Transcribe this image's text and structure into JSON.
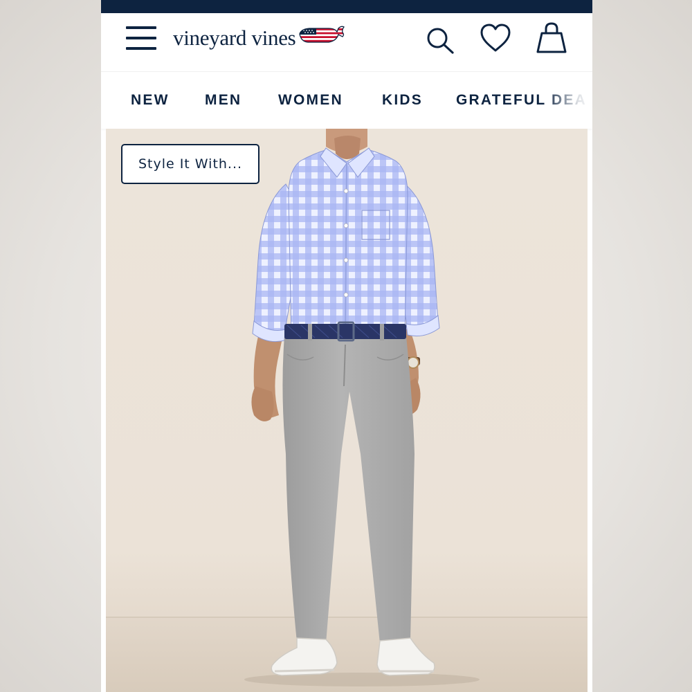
{
  "brand": {
    "name": "vineyard vines",
    "logo_icon": "flag-whale-icon",
    "colors": {
      "navy": "#0d2340",
      "flag_red": "#c8102e",
      "white": "#ffffff"
    }
  },
  "header": {
    "menu_icon": "hamburger-menu-icon",
    "search_icon": "search-icon",
    "wishlist_icon": "heart-icon",
    "cart_icon": "shopping-bag-icon"
  },
  "nav": {
    "items": [
      {
        "label": "NEW"
      },
      {
        "label": "MEN"
      },
      {
        "label": "WOMEN"
      },
      {
        "label": "KIDS"
      },
      {
        "label": "GRATEFUL DEA"
      }
    ]
  },
  "hero": {
    "style_button_label": "Style It With...",
    "subject": "model-wearing-gingham-shirt-and-grey-chinos"
  }
}
